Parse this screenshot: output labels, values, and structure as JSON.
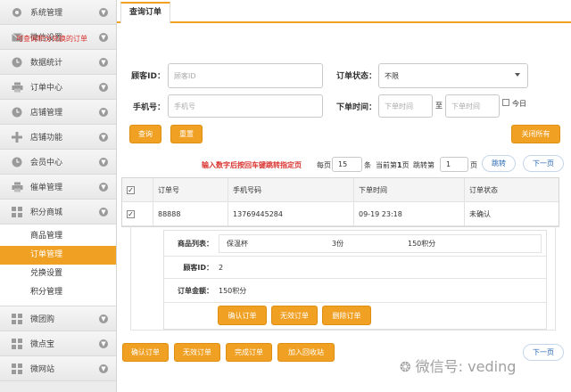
{
  "sidebar": {
    "items_top": [
      {
        "label": "系统管理",
        "icon": "gear-icon"
      },
      {
        "label": "微信设置",
        "icon": "mail-icon"
      },
      {
        "label": "数据统计",
        "icon": "clock-icon"
      },
      {
        "label": "订单中心",
        "icon": "printer-icon"
      },
      {
        "label": "店铺管理",
        "icon": "clock-icon"
      },
      {
        "label": "店铺功能",
        "icon": "plus-icon"
      },
      {
        "label": "会员中心",
        "icon": "clock-icon"
      },
      {
        "label": "催单管理",
        "icon": "printer-icon"
      },
      {
        "label": "积分商城",
        "icon": "grid-icon"
      }
    ],
    "submenu": [
      "商品管理",
      "订单管理",
      "兑换设置",
      "积分管理"
    ],
    "submenu_active_index": 1,
    "items_bottom": [
      {
        "label": "微团购",
        "icon": "grid-icon"
      },
      {
        "label": "微点宝",
        "icon": "grid-icon"
      },
      {
        "label": "微网站",
        "icon": "grid-icon"
      }
    ]
  },
  "tab": {
    "active": "查询订单"
  },
  "tip": "可查询积分兑换的订单",
  "form": {
    "customer_label": "顾客ID：",
    "customer_placeholder": "顾客ID",
    "status_label": "订单状态：",
    "status_value": "不限",
    "phone_label": "手机号：",
    "phone_placeholder": "手机号",
    "time_label": "下单时间：",
    "time_from_placeholder": "下单时间",
    "time_sep": "至",
    "time_to_placeholder": "下单时间",
    "today_label": "今日",
    "search_button": "查询",
    "reset_button": "重置",
    "close_all_button": "关闭所有"
  },
  "pager": {
    "hint": "输入数字后按回车键跳转指定页",
    "per_page_label": "每页",
    "per_page_value": "15",
    "per_page_unit": "条",
    "current_text_pre": "当前第",
    "current_page": "1",
    "current_text_post": "页",
    "jump_label": "跳转第",
    "jump_value": "1",
    "jump_unit": "页",
    "jump_button": "跳转",
    "next_button": "下一页",
    "next_button_bottom": "下一页"
  },
  "table": {
    "headers": [
      "订单号",
      "手机号码",
      "下单时间",
      "订单状态"
    ],
    "rows": [
      {
        "order_no": "88888",
        "phone": "13769445284",
        "time": "09-19 23:18",
        "status": "未确认"
      }
    ]
  },
  "detail": {
    "goods_label": "商品列表：",
    "goods": [
      {
        "name": "保温杯",
        "qty": "3份",
        "points": "150积分"
      }
    ],
    "customer_label": "顾客ID：",
    "customer_value": "2",
    "amount_label": "订单金额：",
    "amount_value": "150积分",
    "buttons": [
      "确认订单",
      "无效订单",
      "删除订单"
    ]
  },
  "bulk_buttons": [
    "确认订单",
    "无效订单",
    "完成订单",
    "加入回收站"
  ],
  "watermark": "微信号: veding",
  "colors": {
    "accent": "#f0a023",
    "tip": "#d9312e",
    "link": "#2668b5"
  }
}
